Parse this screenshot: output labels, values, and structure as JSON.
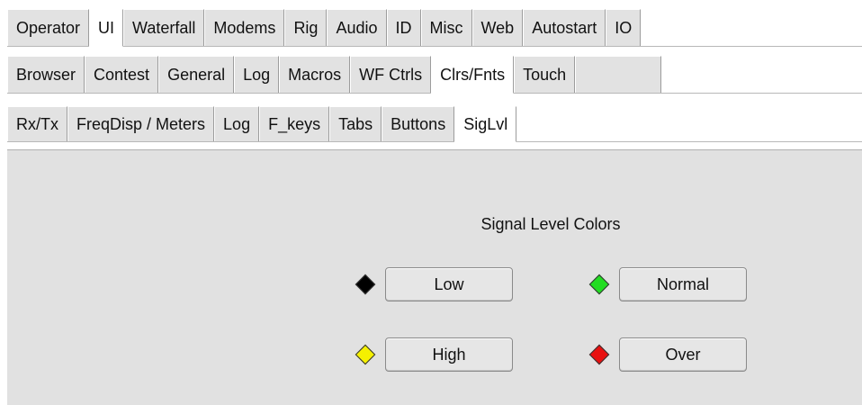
{
  "tabs_level1": [
    {
      "label": "Operator",
      "active": false
    },
    {
      "label": "UI",
      "active": true
    },
    {
      "label": "Waterfall",
      "active": false
    },
    {
      "label": "Modems",
      "active": false
    },
    {
      "label": "Rig",
      "active": false
    },
    {
      "label": "Audio",
      "active": false
    },
    {
      "label": "ID",
      "active": false
    },
    {
      "label": "Misc",
      "active": false
    },
    {
      "label": "Web",
      "active": false
    },
    {
      "label": "Autostart",
      "active": false
    },
    {
      "label": "IO",
      "active": false
    }
  ],
  "tabs_level2": [
    {
      "label": "Browser",
      "active": false
    },
    {
      "label": "Contest",
      "active": false
    },
    {
      "label": "General",
      "active": false
    },
    {
      "label": "Log",
      "active": false
    },
    {
      "label": "Macros",
      "active": false
    },
    {
      "label": "WF Ctrls",
      "active": false
    },
    {
      "label": "Clrs/Fnts",
      "active": true
    },
    {
      "label": "Touch",
      "active": false
    }
  ],
  "tabs_level3": [
    {
      "label": "Rx/Tx",
      "active": false
    },
    {
      "label": "FreqDisp / Meters",
      "active": false
    },
    {
      "label": "Log",
      "active": false
    },
    {
      "label": "F_keys",
      "active": false
    },
    {
      "label": "Tabs",
      "active": false
    },
    {
      "label": "Buttons",
      "active": false
    },
    {
      "label": "SigLvl",
      "active": true
    }
  ],
  "signal_levels": {
    "title": "Signal Level Colors",
    "low": {
      "label": "Low",
      "color": "#000000"
    },
    "normal": {
      "label": "Normal",
      "color": "#22dd22"
    },
    "high": {
      "label": "High",
      "color": "#f5f000"
    },
    "over": {
      "label": "Over",
      "color": "#e81010"
    }
  }
}
